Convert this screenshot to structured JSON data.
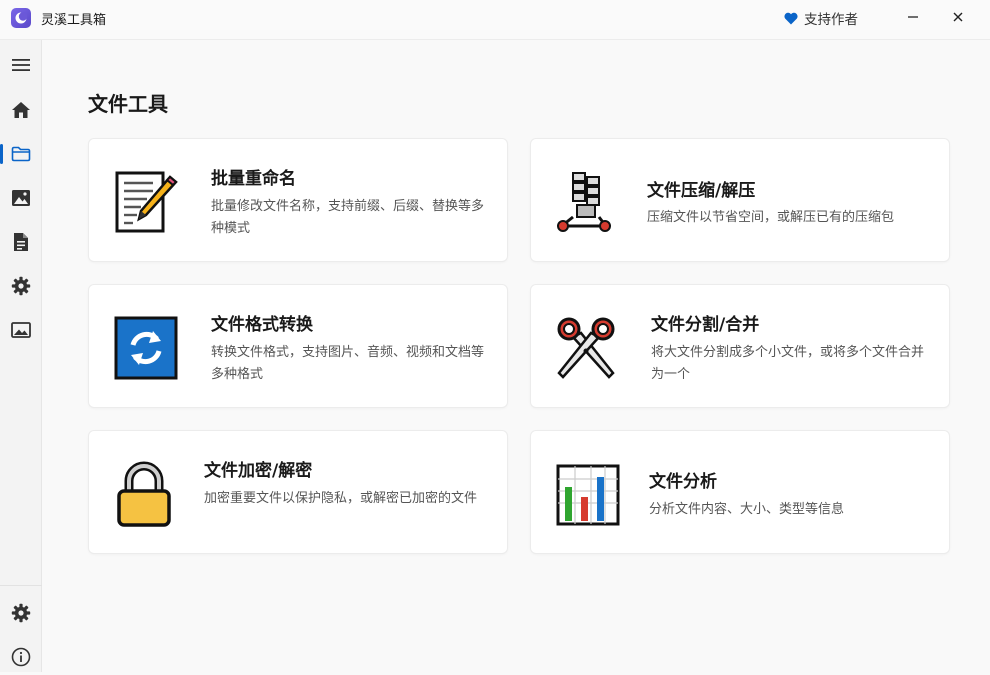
{
  "app": {
    "title": "灵溪工具箱",
    "support_label": "支持作者"
  },
  "colors": {
    "accent": "#0a64c8",
    "heart": "#0a64c8"
  },
  "sidebar": {
    "items": [
      {
        "name": "menu",
        "icon": "hamburger-icon"
      },
      {
        "name": "home",
        "icon": "home-icon"
      },
      {
        "name": "files",
        "icon": "folder-icon",
        "active": true
      },
      {
        "name": "images",
        "icon": "image-icon"
      },
      {
        "name": "documents",
        "icon": "document-icon"
      },
      {
        "name": "settings-tools",
        "icon": "gear-icon"
      },
      {
        "name": "gallery",
        "icon": "picture-icon"
      },
      {
        "name": "settings",
        "icon": "gear-icon"
      },
      {
        "name": "about",
        "icon": "info-icon"
      }
    ]
  },
  "main": {
    "title": "文件工具",
    "cards": [
      {
        "title": "批量重命名",
        "desc": "批量修改文件名称，支持前缀、后缀、替换等多种模式",
        "icon": "notepad-pencil-icon"
      },
      {
        "title": "文件压缩/解压",
        "desc": "压缩文件以节省空间，或解压已有的压缩包",
        "icon": "zipper-icon"
      },
      {
        "title": "文件格式转换",
        "desc": "转换文件格式，支持图片、音频、视频和文档等多种格式",
        "icon": "sync-arrows-icon"
      },
      {
        "title": "文件分割/合并",
        "desc": "将大文件分割成多个小文件，或将多个文件合并为一个",
        "icon": "scissors-icon"
      },
      {
        "title": "文件加密/解密",
        "desc": "加密重要文件以保护隐私，或解密已加密的文件",
        "icon": "padlock-icon"
      },
      {
        "title": "文件分析",
        "desc": "分析文件内容、大小、类型等信息",
        "icon": "bar-chart-icon"
      }
    ]
  }
}
